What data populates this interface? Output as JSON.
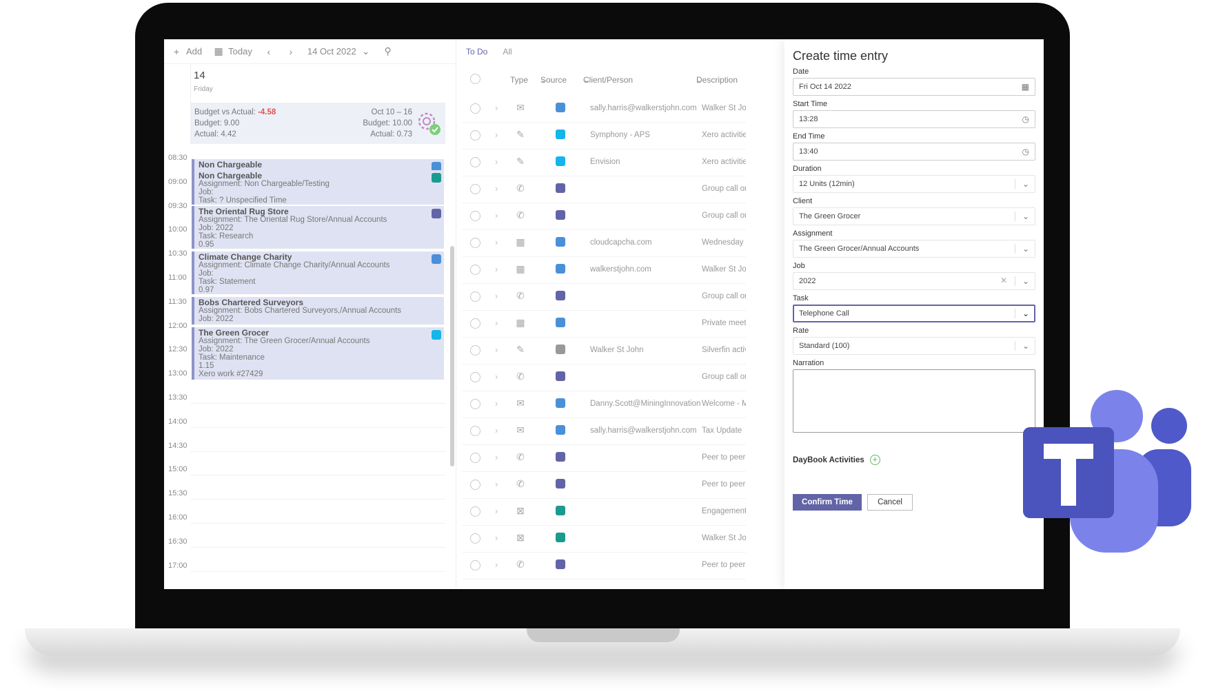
{
  "calendar": {
    "toolbar": {
      "add": "Add",
      "today": "Today",
      "date": "14 Oct 2022"
    },
    "day": {
      "number": "14",
      "name": "Friday"
    },
    "budget": {
      "left_label": "Budget vs Actual:",
      "left_value": "-4.58",
      "budget": "Budget: 9.00",
      "actual": "Actual: 4.42",
      "range": "Oct 10 – 16",
      "range_budget": "Budget: 10.00",
      "range_actual": "Actual: 0.73"
    },
    "times": [
      "08:30",
      "09:00",
      "09:30",
      "10:00",
      "10:30",
      "11:00",
      "11:30",
      "12:00",
      "12:30",
      "13:00",
      "13:30",
      "14:00",
      "14:30",
      "15:00",
      "15:30",
      "16:00",
      "16:30",
      "17:00"
    ],
    "events": [
      {
        "title": "Non Chargeable",
        "lines": []
      },
      {
        "title": "Non Chargeable",
        "lines": [
          "Assignment: Non Chargeable/Testing",
          "Job:",
          "Task: ? Unspecified Time"
        ]
      },
      {
        "title": "The Oriental Rug Store",
        "lines": [
          "Assignment: The Oriental Rug Store/Annual Accounts",
          "Job: 2022",
          "Task: Research",
          "0.95"
        ]
      },
      {
        "title": "Climate Change Charity",
        "lines": [
          "Assignment: Climate Change Charity/Annual Accounts",
          "Job:",
          "Task: Statement",
          "0.97"
        ]
      },
      {
        "title": "Bobs Chartered Surveyors",
        "lines": [
          "Assignment: Bobs Chartered Surveyors,/Annual Accounts",
          "Job: 2022"
        ]
      },
      {
        "title": "The Green Grocer",
        "lines": [
          "Assignment: The Green Grocer/Annual Accounts",
          "Job: 2022",
          "Task: Maintenance",
          "1.15",
          "Xero work #27429"
        ]
      }
    ]
  },
  "list": {
    "tabs": [
      "To Do",
      "All"
    ],
    "headers": {
      "type": "Type",
      "source": "Source",
      "client": "Client/Person",
      "description": "Description"
    },
    "rows": [
      {
        "type_icon": "mail-icon",
        "source": "outlook",
        "client": "sally.harris@walkerstjohn.com",
        "description": "Walker St John A"
      },
      {
        "type_icon": "edit-icon",
        "source": "xero",
        "client": "Symphony - APS",
        "description": "Xero activities"
      },
      {
        "type_icon": "edit-icon",
        "source": "xero",
        "client": "Envision",
        "description": "Xero activities"
      },
      {
        "type_icon": "phone-icon",
        "source": "teams",
        "client": "",
        "description": "Group call organ"
      },
      {
        "type_icon": "phone-icon",
        "source": "teams",
        "client": "",
        "description": "Group call organ"
      },
      {
        "type_icon": "calendar-icon",
        "source": "outlook",
        "client": "cloudcapcha.com",
        "description": "Wednesday Tow"
      },
      {
        "type_icon": "calendar-icon",
        "source": "outlook",
        "client": "walkerstjohn.com",
        "description": "Walker St John A"
      },
      {
        "type_icon": "phone-icon",
        "source": "teams",
        "client": "",
        "description": "Group call organ"
      },
      {
        "type_icon": "calendar-icon",
        "source": "outlook",
        "client": "",
        "description": "Private meeting"
      },
      {
        "type_icon": "edit-icon",
        "source": "silverfin",
        "client": "Walker St John",
        "description": "Silverfin activitie"
      },
      {
        "type_icon": "phone-icon",
        "source": "teams",
        "client": "",
        "description": "Group call organ"
      },
      {
        "type_icon": "mail-icon",
        "source": "outlook",
        "client": "Danny.Scott@MiningInnovation.c",
        "description": "Welcome - Mini"
      },
      {
        "type_icon": "mail-icon",
        "source": "outlook",
        "client": "sally.harris@walkerstjohn.com",
        "description": "Tax Update"
      },
      {
        "type_icon": "phone-icon",
        "source": "teams",
        "client": "",
        "description": "Peer to peer call"
      },
      {
        "type_icon": "phone-icon",
        "source": "teams",
        "client": "",
        "description": "Peer to peer call"
      },
      {
        "type_icon": "excel-icon",
        "source": "sharepoint",
        "client": "",
        "description": "Engagement Let"
      },
      {
        "type_icon": "excel-icon",
        "source": "sharepoint",
        "client": "",
        "description": "Walker St John P"
      },
      {
        "type_icon": "phone-icon",
        "source": "teams",
        "client": "",
        "description": "Peer to peer call"
      }
    ]
  },
  "form": {
    "title": "Create time entry",
    "date_label": "Date",
    "date": "Fri Oct 14 2022",
    "start_label": "Start Time",
    "start": "13:28",
    "end_label": "End Time",
    "end": "13:40",
    "duration_label": "Duration",
    "duration": "12 Units (12min)",
    "client_label": "Client",
    "client": "The Green Grocer",
    "assignment_label": "Assignment",
    "assignment": "The Green Grocer/Annual Accounts",
    "job_label": "Job",
    "job": "2022",
    "task_label": "Task",
    "task": "Telephone Call",
    "rate_label": "Rate",
    "rate": "Standard (100)",
    "narration_label": "Narration",
    "narration": "",
    "daybook": "DayBook Activities",
    "confirm": "Confirm Time",
    "cancel": "Cancel"
  },
  "colors": {
    "accent": "#6264a7",
    "event_bg": "#dfe2f2",
    "negative": "#e05353",
    "outlook": "#4a90d9",
    "xero": "#13b5ea",
    "teams": "#6264a7",
    "sharepoint": "#1a9b8e"
  }
}
